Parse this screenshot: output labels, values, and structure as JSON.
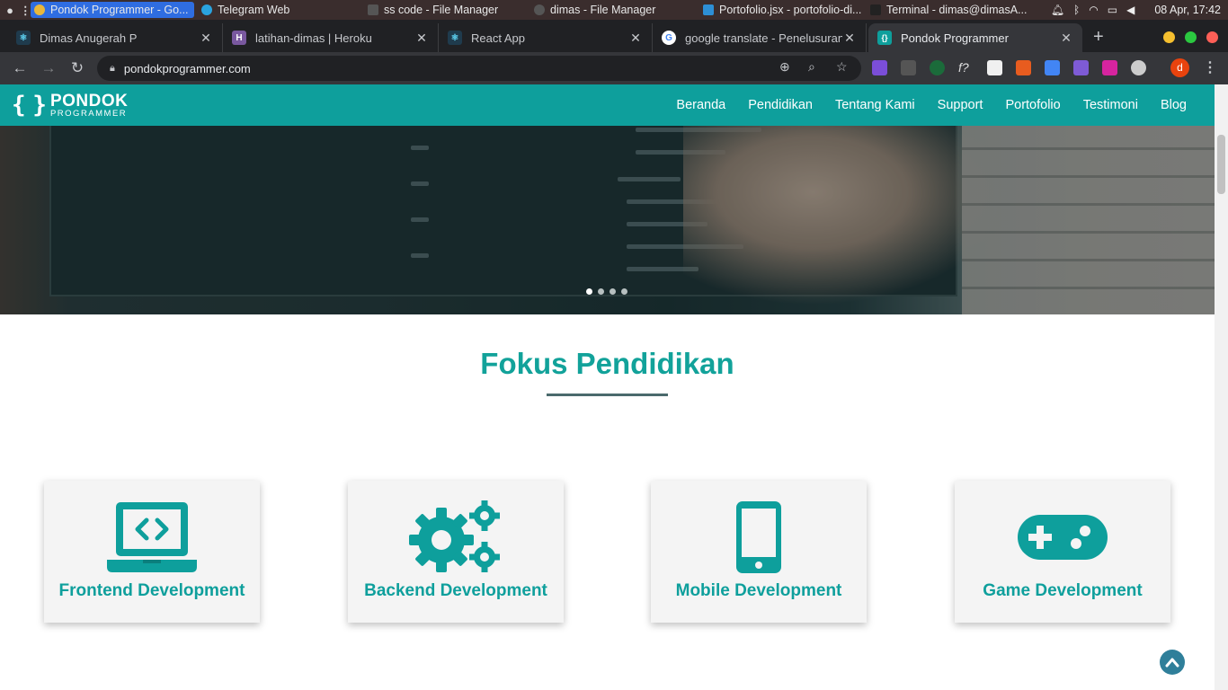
{
  "os": {
    "tasks": [
      {
        "label": "Pondok Programmer - Go...",
        "active": true
      },
      {
        "label": "Telegram Web",
        "active": false
      },
      {
        "label": "ss code - File Manager",
        "active": false
      },
      {
        "label": "dimas - File Manager",
        "active": false
      },
      {
        "label": "Portofolio.jsx - portofolio-di...",
        "active": false
      },
      {
        "label": "Terminal - dimas@dimasA...",
        "active": false
      }
    ],
    "clock": "08 Apr, 17:42"
  },
  "browser": {
    "tabs": [
      {
        "title": "Dimas Anugerah P",
        "favicon": "react-icon",
        "color": "#61dafb"
      },
      {
        "title": "latihan-dimas | Heroku",
        "favicon": "heroku-icon",
        "color": "#79589f"
      },
      {
        "title": "React App",
        "favicon": "react-icon",
        "color": "#61dafb"
      },
      {
        "title": "google translate - Penelusuran",
        "favicon": "google-icon",
        "color": "#4285f4"
      },
      {
        "title": "Pondok Programmer",
        "favicon": "pondok-icon",
        "color": "#0e9f9c"
      }
    ],
    "active_tab": 4,
    "url": "pondokprogrammer.com",
    "profile_initial": "d"
  },
  "site": {
    "logo": {
      "word1": "PONDOK",
      "word2": "PROGRAMMER"
    },
    "menu": [
      "Beranda",
      "Pendidikan",
      "Tentang Kami",
      "Support",
      "Portofolio",
      "Testimoni",
      "Blog"
    ],
    "carousel": {
      "slides": 4,
      "active": 0
    },
    "section_title": "Fokus Pendidikan",
    "cards": [
      {
        "label": "Frontend Development",
        "icon": "laptop-code-icon"
      },
      {
        "label": "Backend Development",
        "icon": "gears-icon"
      },
      {
        "label": "Mobile Development",
        "icon": "mobile-phone-icon"
      },
      {
        "label": "Game Development",
        "icon": "gamepad-icon"
      }
    ],
    "accent_color": "#0e9f9c"
  }
}
